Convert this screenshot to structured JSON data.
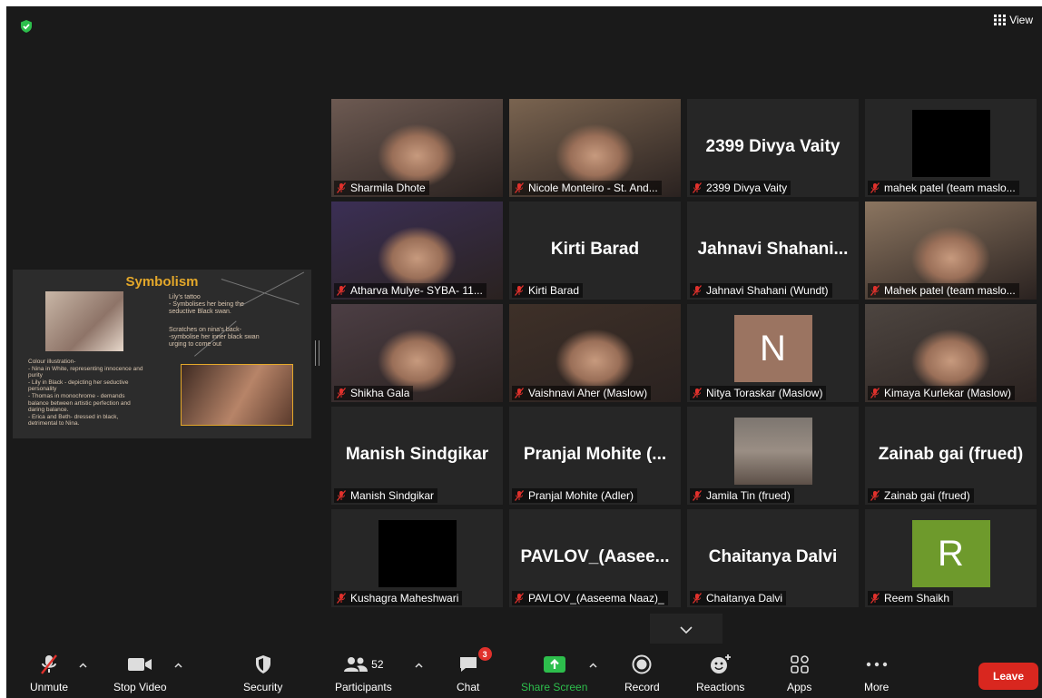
{
  "top": {
    "view_label": "View"
  },
  "slide": {
    "title": "Symbolism",
    "tattoo_text": "Lily's tattoo\n- Symbolises her being the\n  seductive Black swan.",
    "scratch_text": "Scratches on nina's back-\n-symbolise her inner black swan\n urging to come out",
    "colour_text": "Colour illustration-\n- Nina in White, representing innocence and\npurity\n- Lily in Black - depicting her seductive\npersonality\n- Thomas in monochrome - demands\nbalance between artistic perfection and\ndaring balance.\n- Erica and Beth- dressed in black,\ndetrimental to Nina."
  },
  "participants": [
    {
      "name": "Sharmila Dhote",
      "display": "",
      "kind": "video",
      "tone": "#6d5a52"
    },
    {
      "name": "Nicole Monteiro - St. And...",
      "display": "",
      "kind": "video",
      "tone": "#7a6450"
    },
    {
      "name": "2399 Divya Vaity",
      "display": "2399 Divya Vaity",
      "kind": "text"
    },
    {
      "name": "mahek patel (team maslo...",
      "display": "",
      "kind": "black"
    },
    {
      "name": "Atharva Mulye- SYBA- 11...",
      "display": "",
      "kind": "video",
      "tone": "#3b2f55"
    },
    {
      "name": "Kirti Barad",
      "display": "Kirti Barad",
      "kind": "text"
    },
    {
      "name": "Jahnavi Shahani (Wundt)",
      "display": "Jahnavi  Shahani...",
      "kind": "text"
    },
    {
      "name": "Mahek patel (team maslo...",
      "display": "",
      "kind": "video",
      "tone": "#8b7560"
    },
    {
      "name": "Shikha Gala",
      "display": "",
      "kind": "video",
      "tone": "#4c3e44"
    },
    {
      "name": "Vaishnavi Aher (Maslow)",
      "display": "",
      "kind": "video",
      "tone": "#3e3028",
      "active": true
    },
    {
      "name": "Nitya Toraskar (Maslow)",
      "display": "N",
      "kind": "avatar",
      "color": "#9b7461"
    },
    {
      "name": "Kimaya Kurlekar (Maslow)",
      "display": "",
      "kind": "video",
      "tone": "#4d4540"
    },
    {
      "name": "Manish Sindgikar",
      "display": "Manish Sindgikar",
      "kind": "text"
    },
    {
      "name": "Pranjal Mohite (Adler)",
      "display": "Pranjal  Mohite  (...",
      "kind": "text"
    },
    {
      "name": "Jamila Tin (frued)",
      "display": "",
      "kind": "photo"
    },
    {
      "name": "Zainab gai (frued)",
      "display": "Zainab gai (frued)",
      "kind": "text"
    },
    {
      "name": "Kushagra Maheshwari",
      "display": "",
      "kind": "black"
    },
    {
      "name": "PAVLOV_(Aaseema Naaz)_",
      "display": "PAVLOV_(Aasee...",
      "kind": "text"
    },
    {
      "name": "Chaitanya Dalvi",
      "display": "Chaitanya Dalvi",
      "kind": "text"
    },
    {
      "name": "Reem Shaikh",
      "display": "R",
      "kind": "avatar",
      "color": "#6e9a2c"
    }
  ],
  "toolbar": {
    "unmute": "Unmute",
    "stop_video": "Stop Video",
    "security": "Security",
    "participants": "Participants",
    "participants_count": "52",
    "chat": "Chat",
    "chat_badge": "3",
    "share_screen": "Share Screen",
    "record": "Record",
    "reactions": "Reactions",
    "apps": "Apps",
    "more": "More",
    "leave": "Leave"
  },
  "colors": {
    "accent_green": "#2dbe4c",
    "leave_red": "#d9271f",
    "active_speaker": "#d8e63c"
  }
}
